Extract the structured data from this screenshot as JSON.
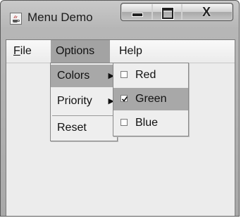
{
  "window": {
    "title": "Menu Demo",
    "controls": {
      "minimize": "minimize",
      "maximize": "maximize",
      "close_glyph": "X"
    }
  },
  "menubar": {
    "items": [
      {
        "mnemonic": "F",
        "rest": "ile"
      },
      {
        "label": "Options"
      },
      {
        "label": "Help"
      }
    ]
  },
  "options_menu": {
    "items": [
      {
        "label": "Colors",
        "has_submenu": true
      },
      {
        "label": "Priority",
        "has_submenu": true
      },
      {
        "label": "Reset"
      }
    ]
  },
  "colors_menu": {
    "items": [
      {
        "label": "Red",
        "checked": false
      },
      {
        "label": "Green",
        "checked": true
      },
      {
        "label": "Blue",
        "checked": false
      }
    ]
  },
  "icons": {
    "app": "java-cup-icon",
    "submenu": "submenu-arrow-icon",
    "check": "checkmark-icon"
  },
  "colors": {
    "highlight": "#a8a8a8",
    "menu_bg": "#eeeeee",
    "client_bg": "#ececec"
  }
}
